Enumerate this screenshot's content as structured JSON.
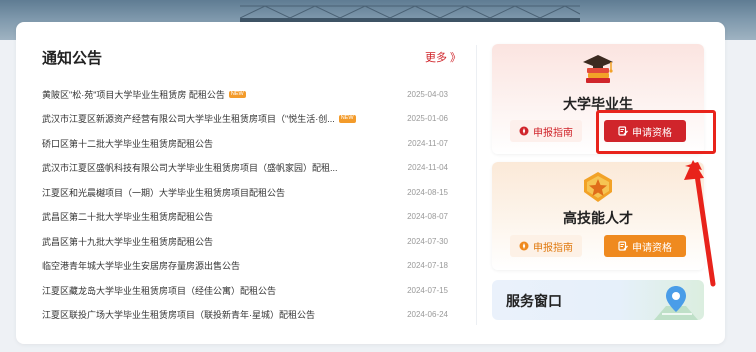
{
  "notice": {
    "title": "通知公告",
    "more": "更多 》",
    "items": [
      {
        "text": "黄陂区\"松·苑\"项目大学毕业生租赁房 配租公告",
        "new": true,
        "new_label": "NEW",
        "date": "2025-04-03"
      },
      {
        "text": "武汉市江夏区新源资产经营有限公司大学毕业生租赁房项目（\"悦生活·创...",
        "new": true,
        "new_label": "NEW",
        "date": "2025-01-06"
      },
      {
        "text": "硚口区第十二批大学毕业生租赁房配租公告",
        "new": false,
        "date": "2024-11-07"
      },
      {
        "text": "武汉市江夏区盛帆科技有限公司大学毕业生租赁房项目（盛帆家园）配租...",
        "new": false,
        "date": "2024-11-04"
      },
      {
        "text": "江夏区和光晨樾项目（一期）大学毕业生租赁房项目配租公告",
        "new": false,
        "date": "2024-08-15"
      },
      {
        "text": "武昌区第二十批大学毕业生租赁房配租公告",
        "new": false,
        "date": "2024-08-07"
      },
      {
        "text": "武昌区第十九批大学毕业生租赁房配租公告",
        "new": false,
        "date": "2024-07-30"
      },
      {
        "text": "临空港青年城大学毕业生安居房存量房源出售公告",
        "new": false,
        "date": "2024-07-18"
      },
      {
        "text": "江夏区藏龙岛大学毕业生租赁房项目（经佳公寓）配租公告",
        "new": false,
        "date": "2024-07-15"
      },
      {
        "text": "江夏区联投广场大学毕业生租赁房项目（联投新青年·星城）配租公告",
        "new": false,
        "date": "2024-06-24"
      }
    ]
  },
  "graduate_card": {
    "title": "大学毕业生",
    "guide_label": "申报指南",
    "apply_label": "申请资格",
    "icon": "graduation-cap-books-icon"
  },
  "skill_card": {
    "title": "高技能人才",
    "guide_label": "申报指南",
    "apply_label": "申请资格",
    "icon": "star-badge-icon"
  },
  "service": {
    "title": "服务窗口",
    "icon": "map-pin-icon"
  },
  "colors": {
    "brand_red": "#d0252b",
    "brand_orange": "#ef8a1f",
    "annotation_red": "#e8231b"
  }
}
